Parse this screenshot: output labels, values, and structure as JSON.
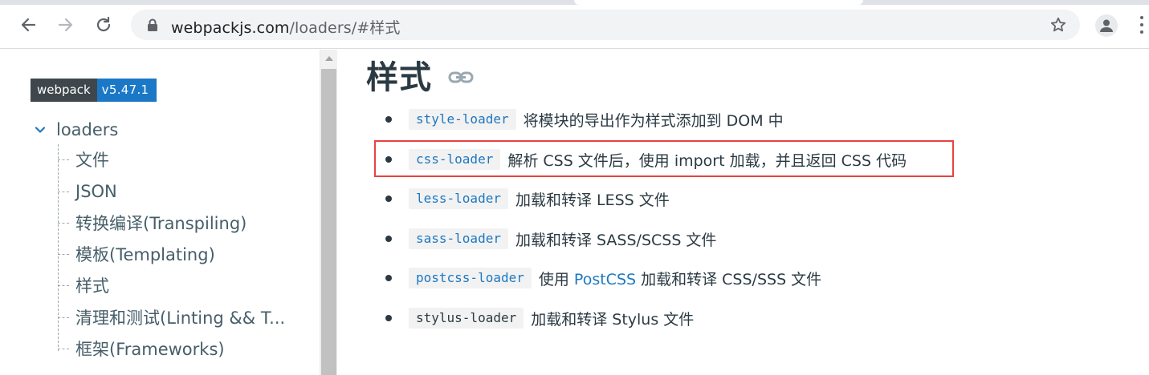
{
  "browser": {
    "url_host": "webpackjs.com",
    "url_path": "/loaders/#样式",
    "icons": {
      "back": "arrow-left-icon",
      "forward": "arrow-right-icon",
      "reload": "reload-icon",
      "lock": "lock-icon",
      "bookmark": "star-icon",
      "profile": "person-icon",
      "menu": "three-dots-icon"
    }
  },
  "sidebar": {
    "version_name": "webpack",
    "version_number": "v5.47.1",
    "root": {
      "label": "loaders",
      "icon": "chevron-down-icon",
      "expanded": true
    },
    "items": [
      {
        "label": "文件"
      },
      {
        "label": "JSON"
      },
      {
        "label": "转换编译(Transpiling)"
      },
      {
        "label": "模板(Templating)"
      },
      {
        "label": "样式"
      },
      {
        "label": "清理和测试(Linting && T..."
      },
      {
        "label": "框架(Frameworks)"
      }
    ]
  },
  "main": {
    "heading": "样式",
    "heading_icon": "link-icon",
    "loaders": [
      {
        "code": "style-loader",
        "desc": "将模块的导出作为样式添加到 DOM 中"
      },
      {
        "code": "css-loader",
        "desc": "解析 CSS 文件后，使用 import 加载，并且返回 CSS 代码",
        "highlighted": true
      },
      {
        "code": "less-loader",
        "desc": "加载和转译 LESS 文件"
      },
      {
        "code": "sass-loader",
        "desc": "加载和转译 SASS/SCSS 文件"
      },
      {
        "code": "postcss-loader",
        "desc_pre": "使用",
        "link": "PostCSS",
        "desc_post": "加载和转译 CSS/SSS 文件"
      },
      {
        "code": "stylus-loader",
        "desc": "加载和转译 Stylus 文件",
        "code_plain": true
      }
    ]
  },
  "colors": {
    "accent": "#1d78c1",
    "highlight_border": "#e8433f",
    "version_badge_dark": "#3f474c",
    "version_badge_blue": "#1b78c7"
  }
}
